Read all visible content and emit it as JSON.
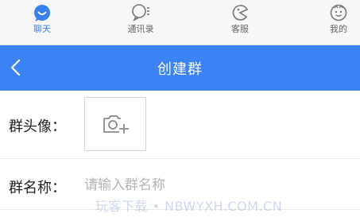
{
  "tabs": [
    {
      "label": "聊天",
      "icon": "chat-icon",
      "active": true
    },
    {
      "label": "通讯录",
      "icon": "contacts-icon",
      "active": false
    },
    {
      "label": "客服",
      "icon": "customer-service-icon",
      "active": false
    },
    {
      "label": "我的",
      "icon": "profile-icon",
      "active": false
    }
  ],
  "header": {
    "title": "创建群",
    "back_icon": "chevron-left-icon"
  },
  "form": {
    "avatar_label": "群头像：",
    "avatar_icon": "camera-add-icon",
    "name_label": "群名称：",
    "name_placeholder": "请输入群名称",
    "name_value": ""
  },
  "watermark": "玩客下载 • NBWYXH.COM.CN",
  "colors": {
    "accent": "#3b82f5",
    "active_tab": "#3a7ff0"
  }
}
